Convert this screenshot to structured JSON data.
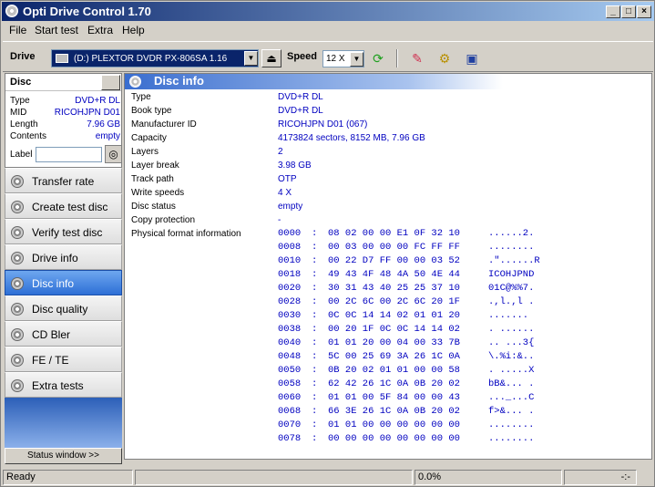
{
  "window": {
    "title": "Opti Drive Control 1.70"
  },
  "menu": [
    "File",
    "Start test",
    "Extra",
    "Help"
  ],
  "toolbar": {
    "drive_label": "Drive",
    "drive_value": "(D:)    PLEXTOR DVDR   PX-806SA 1.16",
    "speed_label": "Speed",
    "speed_value": "12 X"
  },
  "disc": {
    "header": "Disc",
    "rows": [
      {
        "key": "Type",
        "value": "DVD+R DL"
      },
      {
        "key": "MID",
        "value": "RICOHJPN D01"
      },
      {
        "key": "Length",
        "value": "7.96 GB"
      },
      {
        "key": "Contents",
        "value": "empty"
      }
    ],
    "label_key": "Label",
    "label_value": ""
  },
  "nav": [
    {
      "label": "Transfer rate",
      "active": false
    },
    {
      "label": "Create test disc",
      "active": false
    },
    {
      "label": "Verify test disc",
      "active": false
    },
    {
      "label": "Drive info",
      "active": false
    },
    {
      "label": "Disc info",
      "active": true
    },
    {
      "label": "Disc quality",
      "active": false
    },
    {
      "label": "CD Bler",
      "active": false
    },
    {
      "label": "FE / TE",
      "active": false
    },
    {
      "label": "Extra tests",
      "active": false
    }
  ],
  "status_window_button": "Status window >>",
  "content": {
    "title": "Disc info",
    "rows": [
      {
        "key": "Type",
        "value": "DVD+R DL"
      },
      {
        "key": "Book type",
        "value": "DVD+R DL"
      },
      {
        "key": "Manufacturer ID",
        "value": "RICOHJPN D01 (067)"
      },
      {
        "key": "Capacity",
        "value": "4173824 sectors, 8152 MB, 7.96 GB"
      },
      {
        "key": "Layers",
        "value": "2"
      },
      {
        "key": "Layer break",
        "value": "3.98 GB"
      },
      {
        "key": "Track path",
        "value": "OTP"
      },
      {
        "key": "Write speeds",
        "value": "4 X"
      },
      {
        "key": "Disc status",
        "value": "empty"
      },
      {
        "key": "Copy protection",
        "value": "-"
      },
      {
        "key": "Physical format information",
        "value": ""
      }
    ],
    "hex": [
      {
        "offset": "0000",
        "bytes": "08 02 00 00 E1 0F 32 10",
        "ascii": "......2."
      },
      {
        "offset": "0008",
        "bytes": "00 03 00 00 00 FC FF FF",
        "ascii": "........"
      },
      {
        "offset": "0010",
        "bytes": "00 22 D7 FF 00 00 03 52",
        "ascii": ".\"......R"
      },
      {
        "offset": "0018",
        "bytes": "49 43 4F 48 4A 50 4E 44",
        "ascii": "ICOHJPND"
      },
      {
        "offset": "0020",
        "bytes": "30 31 43 40 25 25 37 10",
        "ascii": "01C@%%7."
      },
      {
        "offset": "0028",
        "bytes": "00 2C 6C 00 2C 6C 20 1F",
        "ascii": ".,l.,l ."
      },
      {
        "offset": "0030",
        "bytes": "0C 0C 14 14 02 01 01 20",
        "ascii": "....... "
      },
      {
        "offset": "0038",
        "bytes": "00 20 1F 0C 0C 14 14 02",
        "ascii": ". ......"
      },
      {
        "offset": "0040",
        "bytes": "01 01 20 00 04 00 33 7B",
        "ascii": ".. ...3{"
      },
      {
        "offset": "0048",
        "bytes": "5C 00 25 69 3A 26 1C 0A",
        "ascii": "\\.%i:&.."
      },
      {
        "offset": "0050",
        "bytes": "0B 20 02 01 01 00 00 58",
        "ascii": ". .....X"
      },
      {
        "offset": "0058",
        "bytes": "62 42 26 1C 0A 0B 20 02",
        "ascii": "bB&... ."
      },
      {
        "offset": "0060",
        "bytes": "01 01 00 5F 84 00 00 43",
        "ascii": "..._...C"
      },
      {
        "offset": "0068",
        "bytes": "66 3E 26 1C 0A 0B 20 02",
        "ascii": "f>&... ."
      },
      {
        "offset": "0070",
        "bytes": "01 01 00 00 00 00 00 00",
        "ascii": "........"
      },
      {
        "offset": "0078",
        "bytes": "00 00 00 00 00 00 00 00",
        "ascii": "........"
      }
    ]
  },
  "statusbar": {
    "left": "Ready",
    "progress": "0.0%",
    "time": "-:-"
  }
}
